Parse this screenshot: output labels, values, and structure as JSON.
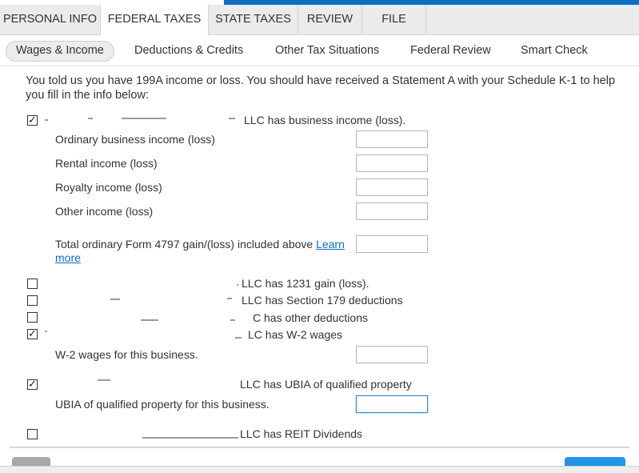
{
  "main_tabs": [
    {
      "label": "PERSONAL INFO"
    },
    {
      "label": "FEDERAL TAXES",
      "active": true
    },
    {
      "label": "STATE TAXES"
    },
    {
      "label": "REVIEW"
    },
    {
      "label": "FILE"
    }
  ],
  "sub_tabs": [
    {
      "label": "Wages & Income",
      "active": true
    },
    {
      "label": "Deductions & Credits"
    },
    {
      "label": "Other Tax Situations"
    },
    {
      "label": "Federal Review"
    },
    {
      "label": "Smart Check"
    }
  ],
  "intro": "You told us you have 199A income or loss. You should have received a Statement A with your Schedule K-1 to help you fill in the info below:",
  "section_business_income": {
    "checked": true,
    "label": "LLC has business income (loss).",
    "fields": [
      {
        "label": "Ordinary business income (loss)",
        "value": ""
      },
      {
        "label": "Rental income (loss)",
        "value": ""
      },
      {
        "label": "Royalty income (loss)",
        "value": ""
      },
      {
        "label": "Other income (loss)",
        "value": ""
      }
    ],
    "form4797": {
      "label": "Total ordinary Form 4797 gain/(loss) included above",
      "link": "Learn more",
      "value": ""
    }
  },
  "option_rows": [
    {
      "label": "LLC has 1231 gain (loss).",
      "checked": false
    },
    {
      "label": "LLC has Section 179 deductions",
      "checked": false
    },
    {
      "label": "C has other deductions",
      "checked": false
    },
    {
      "label": "LC has W-2 wages",
      "checked": true
    }
  ],
  "w2": {
    "label": "W-2 wages for this business.",
    "value": ""
  },
  "ubia_section": {
    "label": "LLC has UBIA of qualified property",
    "checked": true
  },
  "ubia": {
    "label": "UBIA of qualified property for this business.",
    "value": ""
  },
  "reit": {
    "label": "LLC has REIT Dividends",
    "checked": false
  },
  "checkmark": "✓",
  "colors": {
    "accent": "#0d6fc4",
    "link": "#0a6bd1",
    "continue_button": "#2196e8"
  }
}
